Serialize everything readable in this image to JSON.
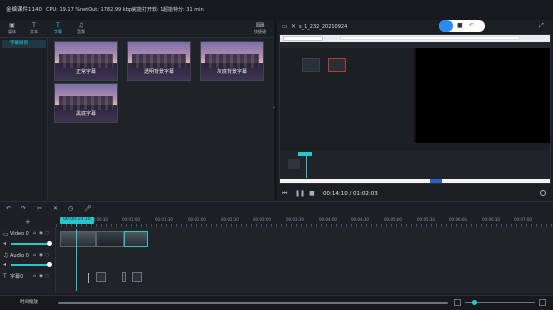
{
  "status": {
    "app_title": "金编课件1140",
    "cpu": "CPU: 19.17 %",
    "net": "netOut: 1782.99 kbps",
    "lag": "完能打开软: 1",
    "fps": "超能特分: 31 min"
  },
  "tools": [
    {
      "label": "媒体",
      "icon": "▣",
      "active": false
    },
    {
      "label": "文本",
      "icon": "T",
      "active": false
    },
    {
      "label": "字幕",
      "icon": "T",
      "active": true
    },
    {
      "label": "音频",
      "icon": "♫",
      "active": false
    }
  ],
  "shortcut_label": "快捷键",
  "nav": {
    "selected": "字幕样例"
  },
  "media_items": [
    {
      "caption": "正常字幕"
    },
    {
      "caption": "透明背景字幕"
    },
    {
      "caption": "灰底背景字幕"
    },
    {
      "caption": "黑底字幕"
    }
  ],
  "preview": {
    "title": "s_1_232_20210924",
    "timecode": "00:14:10 / 01:02:03"
  },
  "timeline": {
    "ruler": [
      "00:00:00",
      "00:00:30",
      "00:01:00",
      "00:01:30",
      "00:02:00",
      "00:02:30",
      "00:03:00",
      "00:03:30",
      "00:04:00",
      "00:04:30",
      "00:05:00",
      "00:05:30",
      "00:06:00",
      "00:06:30",
      "00:07:00"
    ],
    "playhead_time": "00:00:14:10",
    "tracks": [
      {
        "name": "Video 0"
      },
      {
        "name": "Audio 0"
      },
      {
        "name": "字幕0"
      }
    ]
  },
  "bottom": {
    "label": "时间缩放"
  },
  "colors": {
    "accent": "#27c6cf",
    "panel": "#1f2328"
  },
  "icons": [
    "undo-icon",
    "redo-icon",
    "cut-icon",
    "copy-icon",
    "delete-icon",
    "zoom-out-icon",
    "zoom-in-icon",
    "play-icon",
    "pause-icon",
    "fullscreen-icon"
  ]
}
